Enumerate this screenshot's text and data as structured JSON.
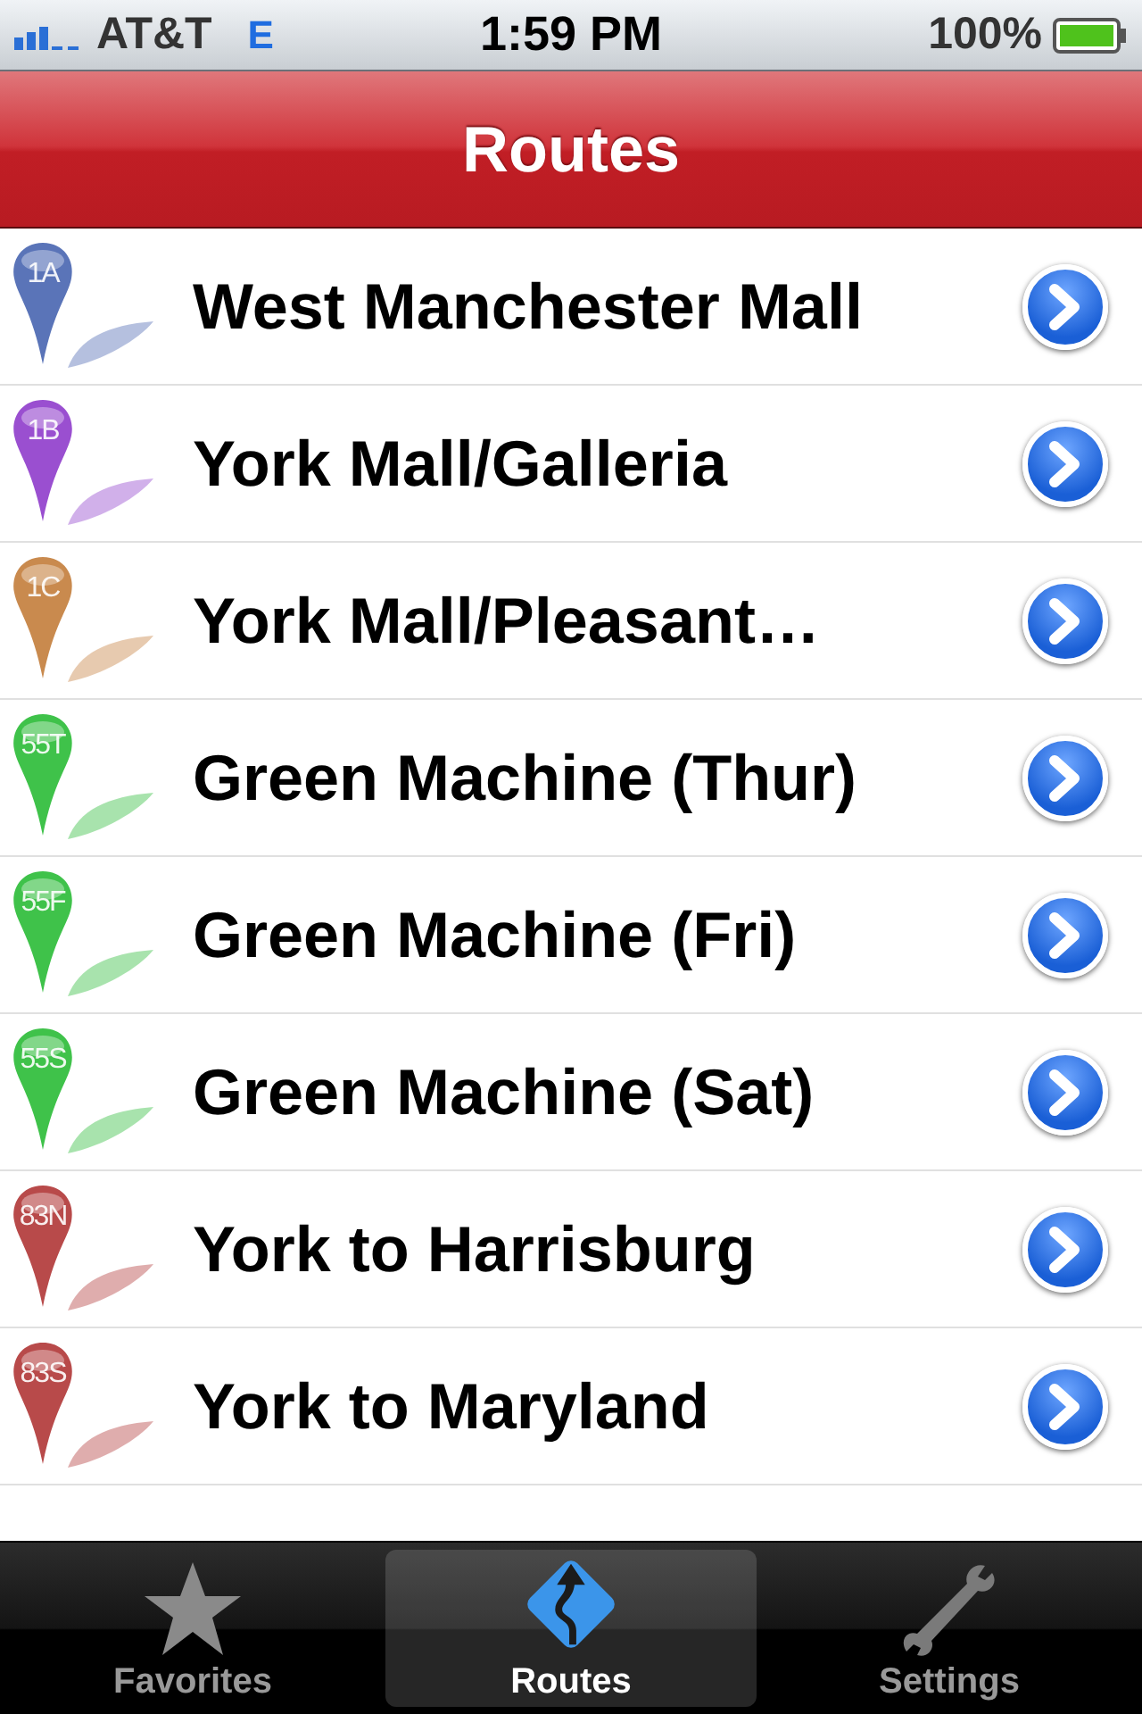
{
  "status_bar": {
    "carrier": "AT&T",
    "network": "E",
    "time": "1:59 PM",
    "battery": "100%"
  },
  "nav_bar": {
    "title": "Routes"
  },
  "routes": [
    {
      "code": "1A",
      "name": "West Manchester Mall",
      "color": "#5a74b8"
    },
    {
      "code": "1B",
      "name": "York Mall/Galleria",
      "color": "#9a4fd0"
    },
    {
      "code": "1C",
      "name": "York Mall/Pleasant…",
      "color": "#c98a4e"
    },
    {
      "code": "55T",
      "name": "Green Machine (Thur)",
      "color": "#3fc24a"
    },
    {
      "code": "55F",
      "name": "Green Machine (Fri)",
      "color": "#3fc24a"
    },
    {
      "code": "55S",
      "name": "Green Machine (Sat)",
      "color": "#3fc24a"
    },
    {
      "code": "83N",
      "name": "York to Harrisburg",
      "color": "#b84a4a"
    },
    {
      "code": "83S",
      "name": "York to Maryland",
      "color": "#b84a4a"
    }
  ],
  "tabs": [
    {
      "kind": "star",
      "label": "Favorites",
      "selected": false
    },
    {
      "kind": "road",
      "label": "Routes",
      "selected": true
    },
    {
      "kind": "wrench",
      "label": "Settings",
      "selected": false
    }
  ]
}
